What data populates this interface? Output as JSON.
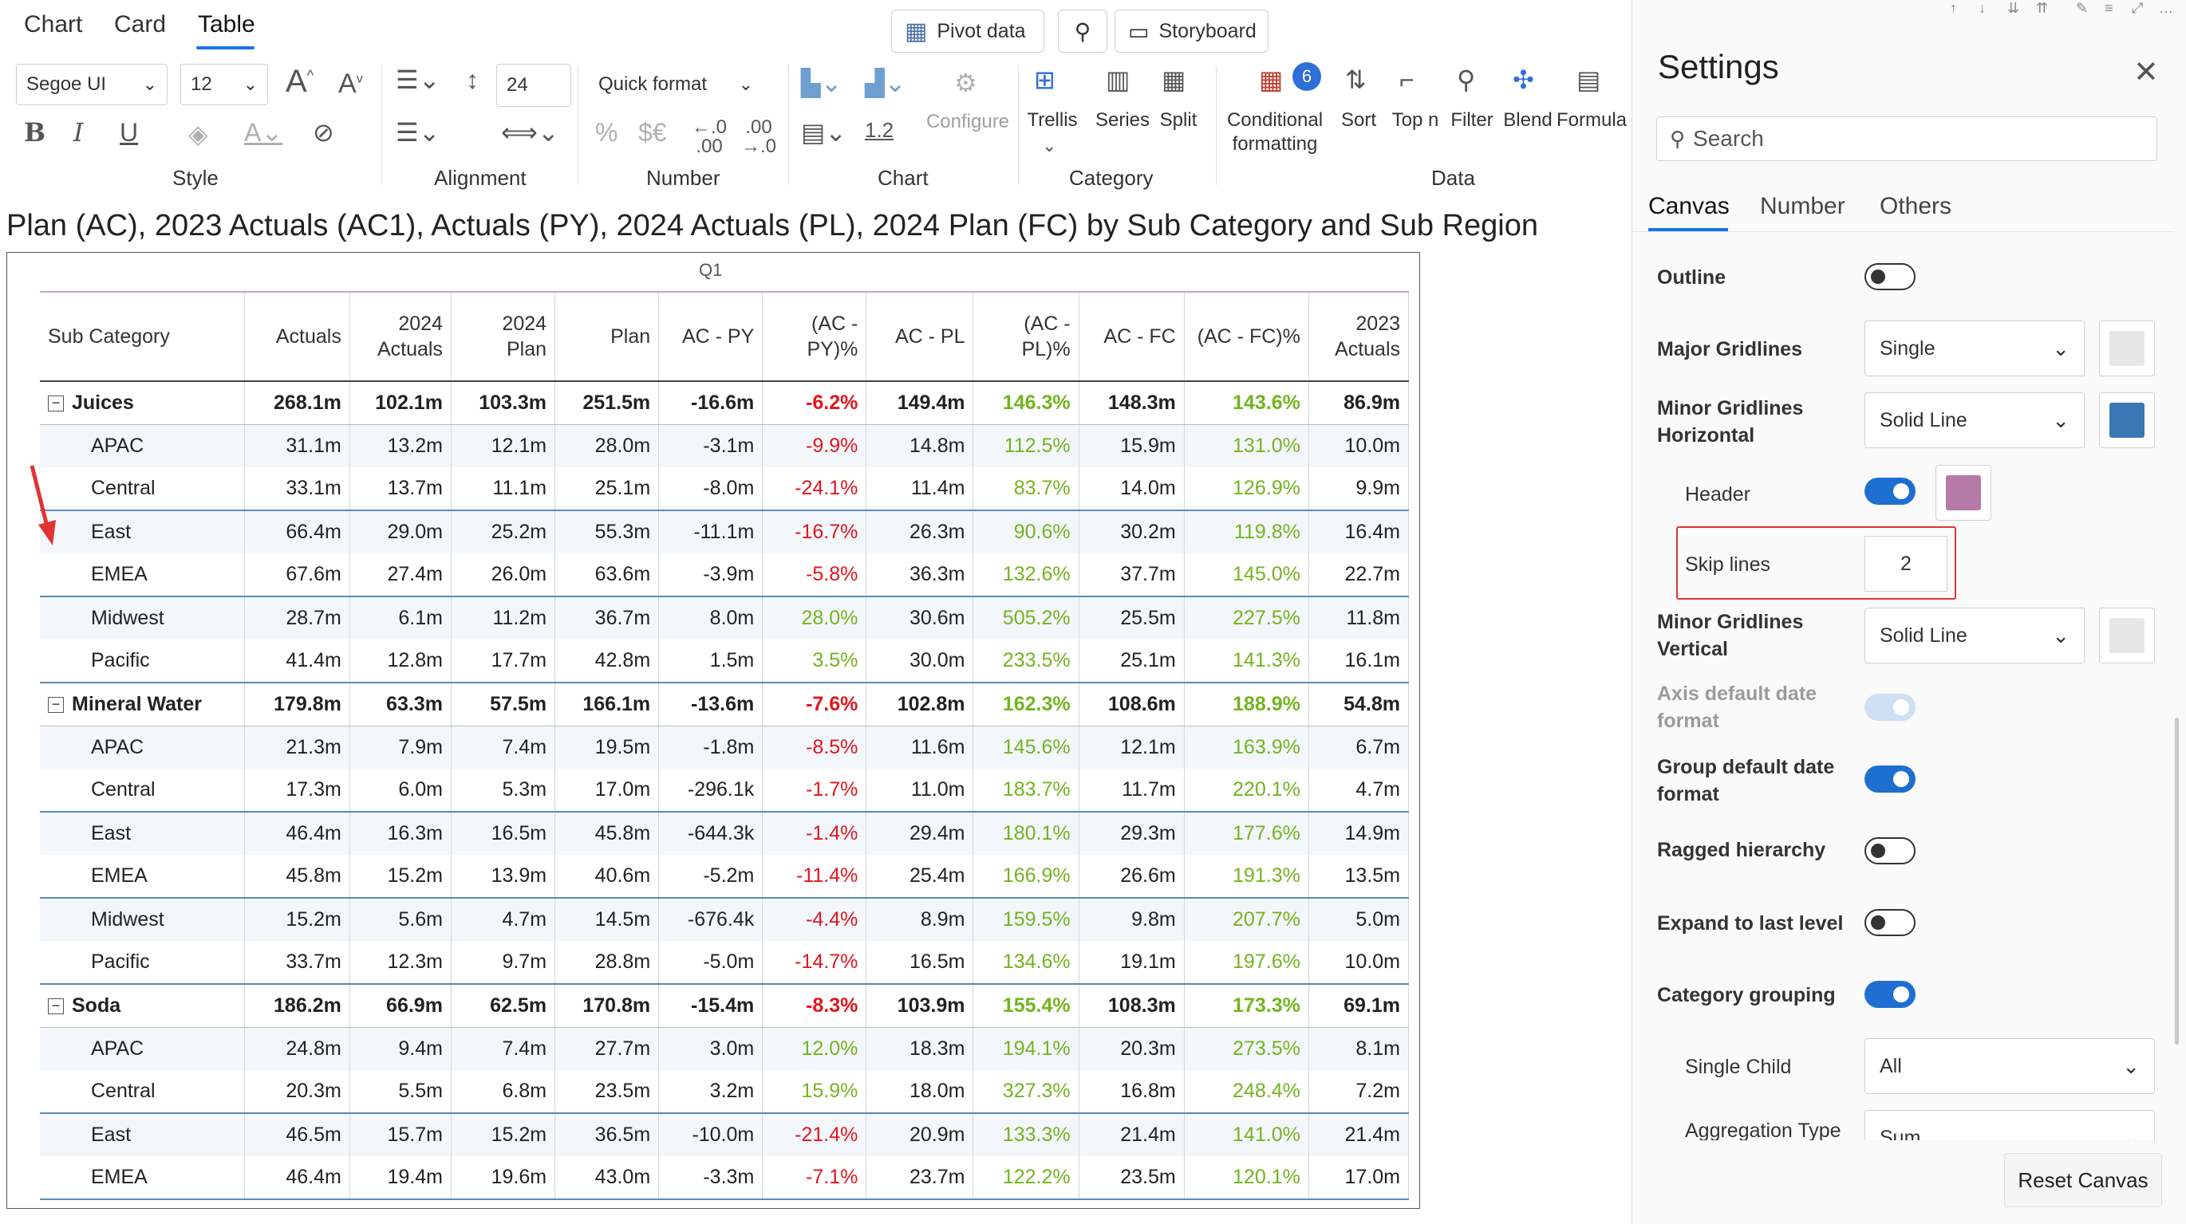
{
  "ribbon": {
    "tabs": [
      "Chart",
      "Card",
      "Table"
    ],
    "active_tab": "Table",
    "pivot_label": "Pivot data",
    "storyboard_label": "Storyboard",
    "font_family": "Segoe UI",
    "font_size": "12",
    "line_height_value": "24",
    "quick_format": "Quick format",
    "number_icons": [
      "%",
      "$€",
      "←.0 .00",
      ".00 →.0"
    ],
    "chart_value": "1.2",
    "configure_label": "Configure",
    "trellis_label": "Trellis",
    "series_label": "Series",
    "split_label": "Split",
    "conditional_label": "Conditional formatting",
    "conditional_badge": "6",
    "sort_label": "Sort",
    "topn_label": "Top n",
    "filter_label": "Filter",
    "blend_label": "Blend",
    "formula_label": "Formula",
    "groups": [
      "Style",
      "Alignment",
      "Number",
      "Chart",
      "Category",
      "Data"
    ]
  },
  "title": "Plan (AC), 2023 Actuals (AC1), Actuals (PY), 2024 Actuals (PL), 2024 Plan (FC) by Sub Category and Sub Region",
  "table": {
    "period": "Q1",
    "columns": [
      "Sub Category",
      "Actuals",
      "2024 Actuals",
      "2024 Plan",
      "Plan",
      "AC - PY",
      "(AC - PY)%",
      "AC - PL",
      "(AC - PL)%",
      "AC - FC",
      "(AC - FC)%",
      "2023 Actuals"
    ],
    "rows": [
      {
        "type": "group",
        "name": "Juices",
        "values": [
          "268.1m",
          "102.1m",
          "103.3m",
          "251.5m",
          "-16.6m",
          "-6.2%",
          "149.4m",
          "146.3%",
          "148.3m",
          "143.6%",
          "86.9m"
        ]
      },
      {
        "type": "child",
        "name": "APAC",
        "values": [
          "31.1m",
          "13.2m",
          "12.1m",
          "28.0m",
          "-3.1m",
          "-9.9%",
          "14.8m",
          "112.5%",
          "15.9m",
          "131.0%",
          "10.0m"
        ]
      },
      {
        "type": "child",
        "name": "Central",
        "values": [
          "33.1m",
          "13.7m",
          "11.1m",
          "25.1m",
          "-8.0m",
          "-24.1%",
          "11.4m",
          "83.7%",
          "14.0m",
          "126.9%",
          "9.9m"
        ]
      },
      {
        "type": "child",
        "name": "East",
        "values": [
          "66.4m",
          "29.0m",
          "25.2m",
          "55.3m",
          "-11.1m",
          "-16.7%",
          "26.3m",
          "90.6%",
          "30.2m",
          "119.8%",
          "16.4m"
        ]
      },
      {
        "type": "child",
        "name": "EMEA",
        "values": [
          "67.6m",
          "27.4m",
          "26.0m",
          "63.6m",
          "-3.9m",
          "-5.8%",
          "36.3m",
          "132.6%",
          "37.7m",
          "145.0%",
          "22.7m"
        ]
      },
      {
        "type": "child",
        "name": "Midwest",
        "values": [
          "28.7m",
          "6.1m",
          "11.2m",
          "36.7m",
          "8.0m",
          "28.0%",
          "30.6m",
          "505.2%",
          "25.5m",
          "227.5%",
          "11.8m"
        ]
      },
      {
        "type": "child",
        "name": "Pacific",
        "values": [
          "41.4m",
          "12.8m",
          "17.7m",
          "42.8m",
          "1.5m",
          "3.5%",
          "30.0m",
          "233.5%",
          "25.1m",
          "141.3%",
          "16.1m"
        ]
      },
      {
        "type": "group",
        "name": "Mineral Water",
        "values": [
          "179.8m",
          "63.3m",
          "57.5m",
          "166.1m",
          "-13.6m",
          "-7.6%",
          "102.8m",
          "162.3%",
          "108.6m",
          "188.9%",
          "54.8m"
        ]
      },
      {
        "type": "child",
        "name": "APAC",
        "values": [
          "21.3m",
          "7.9m",
          "7.4m",
          "19.5m",
          "-1.8m",
          "-8.5%",
          "11.6m",
          "145.6%",
          "12.1m",
          "163.9%",
          "6.7m"
        ]
      },
      {
        "type": "child",
        "name": "Central",
        "values": [
          "17.3m",
          "6.0m",
          "5.3m",
          "17.0m",
          "-296.1k",
          "-1.7%",
          "11.0m",
          "183.7%",
          "11.7m",
          "220.1%",
          "4.7m"
        ]
      },
      {
        "type": "child",
        "name": "East",
        "values": [
          "46.4m",
          "16.3m",
          "16.5m",
          "45.8m",
          "-644.3k",
          "-1.4%",
          "29.4m",
          "180.1%",
          "29.3m",
          "177.6%",
          "14.9m"
        ]
      },
      {
        "type": "child",
        "name": "EMEA",
        "values": [
          "45.8m",
          "15.2m",
          "13.9m",
          "40.6m",
          "-5.2m",
          "-11.4%",
          "25.4m",
          "166.9%",
          "26.6m",
          "191.3%",
          "13.5m"
        ]
      },
      {
        "type": "child",
        "name": "Midwest",
        "values": [
          "15.2m",
          "5.6m",
          "4.7m",
          "14.5m",
          "-676.4k",
          "-4.4%",
          "8.9m",
          "159.5%",
          "9.8m",
          "207.7%",
          "5.0m"
        ]
      },
      {
        "type": "child",
        "name": "Pacific",
        "values": [
          "33.7m",
          "12.3m",
          "9.7m",
          "28.8m",
          "-5.0m",
          "-14.7%",
          "16.5m",
          "134.6%",
          "19.1m",
          "197.6%",
          "10.0m"
        ]
      },
      {
        "type": "group",
        "name": "Soda",
        "values": [
          "186.2m",
          "66.9m",
          "62.5m",
          "170.8m",
          "-15.4m",
          "-8.3%",
          "103.9m",
          "155.4%",
          "108.3m",
          "173.3%",
          "69.1m"
        ]
      },
      {
        "type": "child",
        "name": "APAC",
        "values": [
          "24.8m",
          "9.4m",
          "7.4m",
          "27.7m",
          "3.0m",
          "12.0%",
          "18.3m",
          "194.1%",
          "20.3m",
          "273.5%",
          "8.1m"
        ]
      },
      {
        "type": "child",
        "name": "Central",
        "values": [
          "20.3m",
          "5.5m",
          "6.8m",
          "23.5m",
          "3.2m",
          "15.9%",
          "18.0m",
          "327.3%",
          "16.8m",
          "248.4%",
          "7.2m"
        ]
      },
      {
        "type": "child",
        "name": "East",
        "values": [
          "46.5m",
          "15.7m",
          "15.2m",
          "36.5m",
          "-10.0m",
          "-21.4%",
          "20.9m",
          "133.3%",
          "21.4m",
          "141.0%",
          "21.4m"
        ]
      },
      {
        "type": "child",
        "name": "EMEA",
        "values": [
          "46.4m",
          "19.4m",
          "19.6m",
          "43.0m",
          "-3.3m",
          "-7.1%",
          "23.7m",
          "122.2%",
          "23.5m",
          "120.1%",
          "17.0m"
        ]
      }
    ]
  },
  "settings": {
    "title": "Settings",
    "search_placeholder": "Search",
    "tabs": [
      "Canvas",
      "Number",
      "Others"
    ],
    "active_tab": "Canvas",
    "outline": {
      "label": "Outline",
      "on": false
    },
    "major_gridlines": {
      "label": "Major Gridlines",
      "value": "Single",
      "color": "#e6e6e6"
    },
    "minor_h": {
      "label": "Minor Gridlines Horizontal",
      "value": "Solid Line",
      "color": "#3a77b5"
    },
    "header": {
      "label": "Header",
      "on": true,
      "color": "#b67aa8"
    },
    "skip_lines": {
      "label": "Skip lines",
      "value": "2"
    },
    "minor_v": {
      "label": "Minor Gridlines Vertical",
      "value": "Solid Line",
      "color": "#e6e6e6"
    },
    "axis_date": {
      "label": "Axis default date format",
      "on": true,
      "disabled": true
    },
    "group_date": {
      "label": "Group default date format",
      "on": true
    },
    "ragged": {
      "label": "Ragged hierarchy",
      "on": false
    },
    "expand_last": {
      "label": "Expand to last level",
      "on": false
    },
    "category_grouping": {
      "label": "Category grouping",
      "on": true
    },
    "single_child": {
      "label": "Single Child",
      "value": "All"
    },
    "aggregation": {
      "label": "Aggregation Type",
      "value": "Sum"
    },
    "reset_label": "Reset Canvas"
  },
  "colors": {
    "negative": "#e3141c",
    "positive": "#73b41e",
    "accent": "#1a73e8",
    "annotation": "#e23333"
  }
}
